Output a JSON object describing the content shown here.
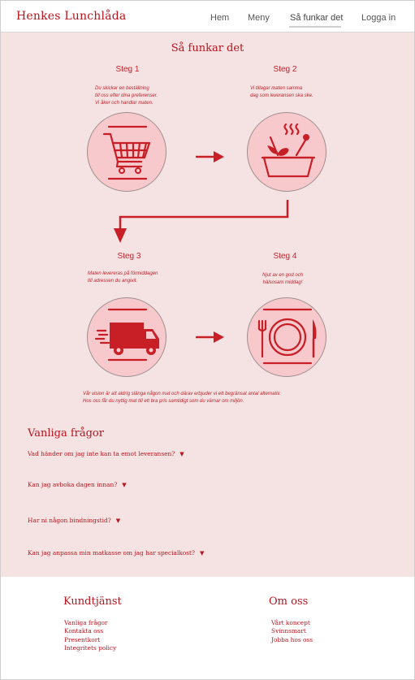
{
  "brand": "Henkes Lunchlåda",
  "nav": {
    "home": "Hem",
    "menu": "Meny",
    "how": "Så funkar det",
    "login": "Logga in"
  },
  "page_title": "Så funkar det",
  "steps": [
    {
      "label": "Steg 1",
      "desc": [
        "Du skickar en beställning",
        "till oss efter dina preferenser.",
        "Vi åker och handlar maten."
      ],
      "icon": "shopping-cart-icon"
    },
    {
      "label": "Steg 2",
      "desc": [
        "Vi tillagar maten samma",
        "dag som leveransen ska ske."
      ],
      "icon": "cooking-pot-icon"
    },
    {
      "label": "Steg 3",
      "desc": [
        "Maten levereras på förmiddagen",
        "till adressen du angivit."
      ],
      "icon": "delivery-truck-icon"
    },
    {
      "label": "Steg 4",
      "desc": [
        "Njut av en god och",
        "hälsosam middag!"
      ],
      "icon": "plate-cutlery-icon"
    }
  ],
  "vision": [
    "Vår vision är att aldrig slänga någon mat och därav erbjuder vi ett begränsat antal alternativ.",
    "Hos oss får du nyttig mat till ett bra pris samtidigt som du värnar om miljön."
  ],
  "faq": {
    "title": "Vanliga frågor",
    "caret": "▼",
    "questions": [
      "Vad händer om jag inte kan ta emot leveransen?",
      "Kan jag avboka dagen innan?",
      "Har ni någon bindningstid?",
      "Kan jag anpassa min matkasse om jag har specialkost?"
    ]
  },
  "footer": {
    "service": {
      "title": "Kundtjänst",
      "links": [
        "Vanliga frågor",
        "Kontakta oss",
        "Presentkort",
        "Integritets policy"
      ]
    },
    "about": {
      "title": "Om oss",
      "links": [
        "Vårt koncept",
        "Svinnsmart",
        "Jobba hos oss"
      ]
    }
  },
  "colors": {
    "accent": "#b8141d",
    "background": "#f5e3e3",
    "circle": "#f7c9cc"
  }
}
